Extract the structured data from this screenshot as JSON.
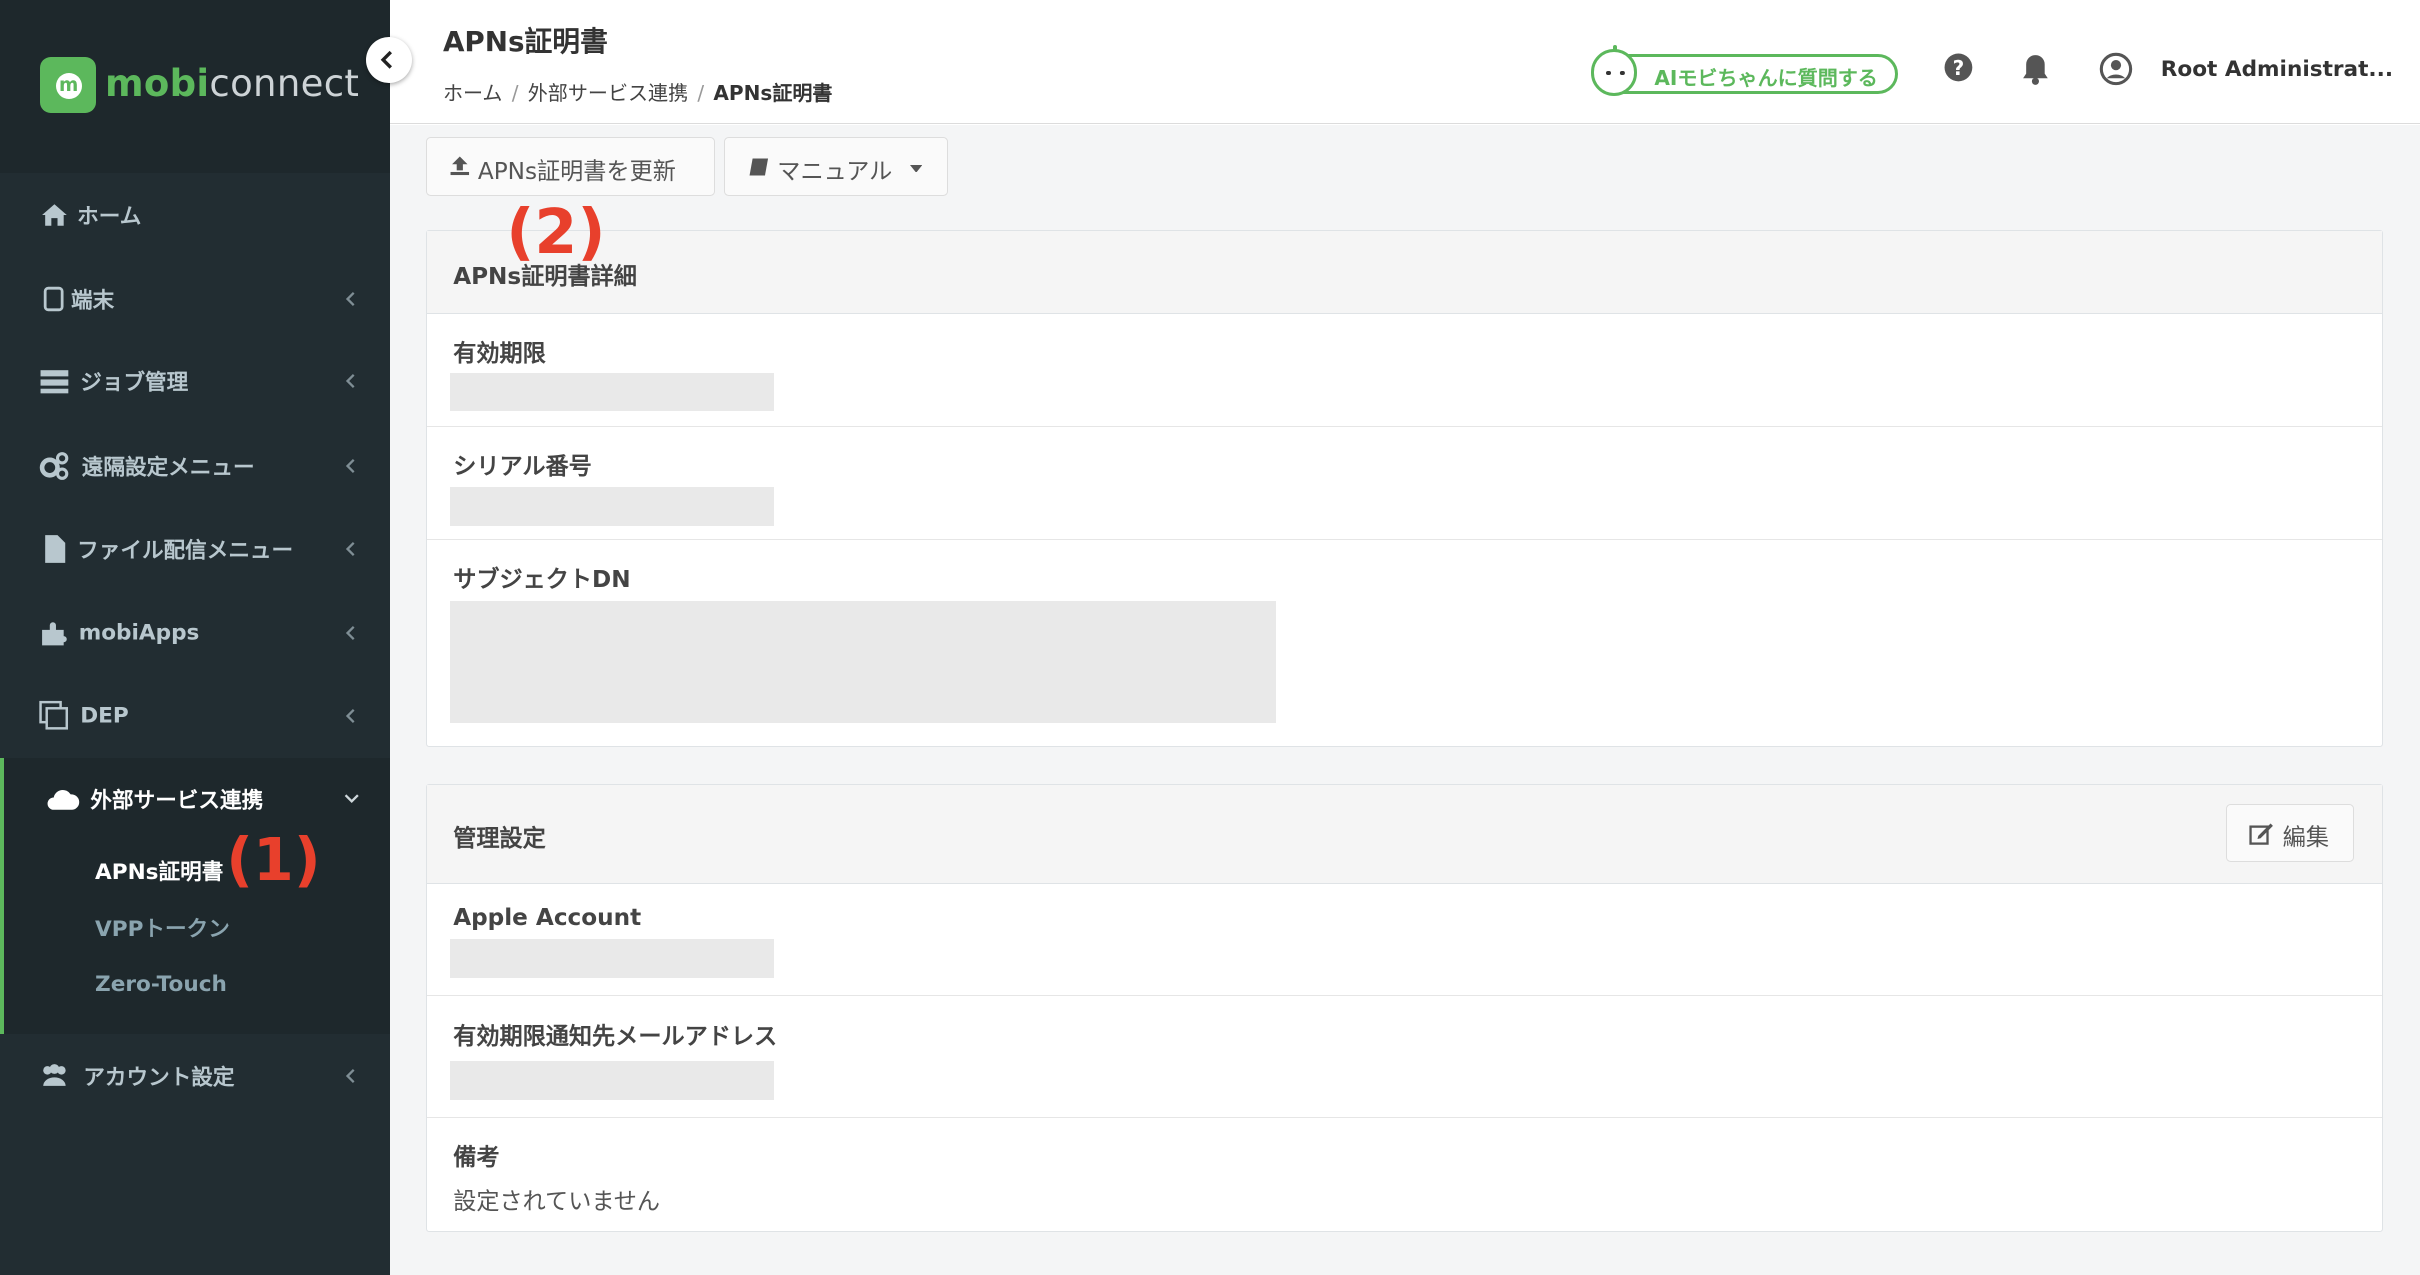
{
  "app": {
    "logo_text_bold": "m",
    "logo_text": "mobiconnect",
    "logo_badge": "m"
  },
  "sidebar": {
    "items": [
      {
        "label": "ホーム",
        "icon": "home-icon"
      },
      {
        "label": "端末",
        "icon": "device-icon"
      },
      {
        "label": "ジョブ管理",
        "icon": "server-icon"
      },
      {
        "label": "遠隔設定メニュー",
        "icon": "gears-icon"
      },
      {
        "label": "ファイル配信メニュー",
        "icon": "file-icon"
      },
      {
        "label": "mobiApps",
        "icon": "puzzle-icon"
      },
      {
        "label": "DEP",
        "icon": "copy-icon"
      },
      {
        "label": "外部サービス連携",
        "icon": "cloud-icon"
      },
      {
        "label": "アカウント設定",
        "icon": "users-icon"
      }
    ],
    "submenu": [
      {
        "label": "APNs証明書"
      },
      {
        "label": "VPPトークン"
      },
      {
        "label": "Zero-Touch"
      }
    ]
  },
  "annotations": {
    "one": "(1)",
    "two": "(2)"
  },
  "header": {
    "title": "APNs証明書",
    "breadcrumb": [
      "ホーム",
      "外部サービス連携",
      "APNs証明書"
    ],
    "ai_button": "AIモビちゃんに質問する",
    "user": "Root Administrat..."
  },
  "toolbar": {
    "update_label": "APNs証明書を更新",
    "manual_label": "マニュアル"
  },
  "details_panel": {
    "title": "APNs証明書詳細",
    "rows": [
      {
        "label": "有効期限"
      },
      {
        "label": "シリアル番号"
      },
      {
        "label": "サブジェクトDN"
      }
    ]
  },
  "settings_panel": {
    "title": "管理設定",
    "edit_label": "編集",
    "rows": [
      {
        "label": "Apple Account"
      },
      {
        "label": "有効期限通知先メールアドレス"
      },
      {
        "label": "備考",
        "value": "設定されていません"
      }
    ]
  },
  "colors": {
    "accent": "#5cb85c",
    "sidebar": "#222d32",
    "annotation": "#e8402c"
  }
}
